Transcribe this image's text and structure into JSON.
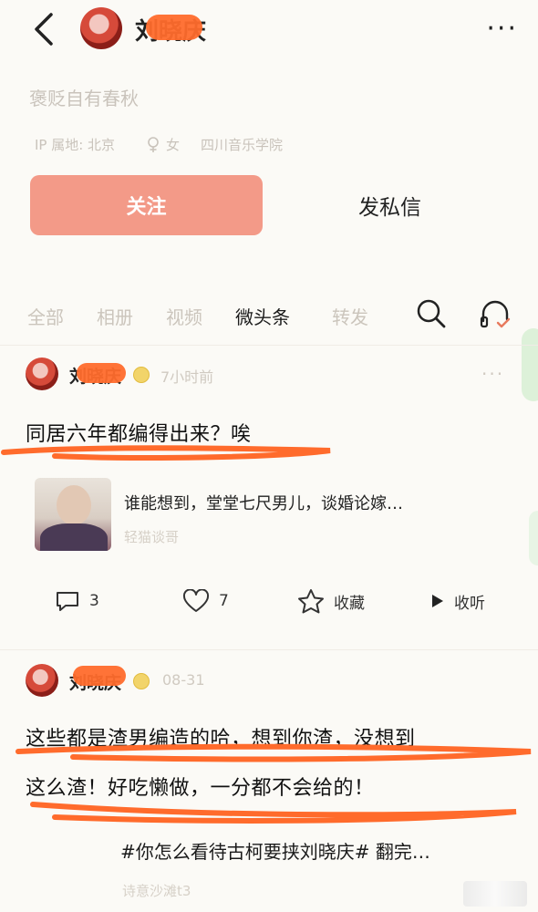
{
  "header": {
    "name": "刘晓庆",
    "more_label": "···"
  },
  "profile": {
    "bio": "褒贬自有春秋",
    "ip_location": "IP 属地: 北京",
    "gender": "女",
    "school": "四川音乐学院",
    "follow_label": "关注",
    "message_label": "发私信"
  },
  "tabs": [
    {
      "label": "全部",
      "active": false
    },
    {
      "label": "相册",
      "active": false
    },
    {
      "label": "视频",
      "active": false
    },
    {
      "label": "微头条",
      "active": true
    },
    {
      "label": "转发",
      "active": false
    }
  ],
  "posts": [
    {
      "author": "刘晓庆",
      "time": "7小时前",
      "text": "同居六年都编得出来？唉",
      "article": {
        "title": "谁能想到，堂堂七尺男儿，谈婚论嫁…",
        "source": "轻猫谈哥"
      },
      "actions": {
        "comments": "3",
        "likes": "7",
        "collect_label": "收藏",
        "listen_label": "收听"
      }
    },
    {
      "author": "刘晓庆",
      "time": "08-31",
      "text_line1": "这些都是渣男编造的哈，想到你渣，没想到",
      "text_line2": "这么渣！好吃懒做，一分都不会给的！",
      "article_title": "#你怎么看待古柯要挟刘晓庆# 翻完…",
      "article_source": "诗意沙滩t3"
    }
  ],
  "colors": {
    "accent": "#f39a88",
    "underline": "#ff6b2c",
    "muted": "#c9c3bb"
  }
}
